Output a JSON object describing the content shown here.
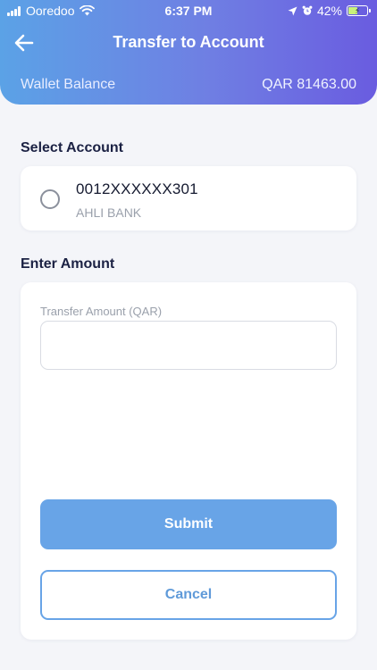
{
  "status_bar": {
    "carrier": "Ooredoo",
    "time": "6:37 PM",
    "battery": "42%"
  },
  "header": {
    "title": "Transfer to Account",
    "wallet_label": "Wallet Balance",
    "wallet_value": "QAR 81463.00"
  },
  "select_account": {
    "title": "Select Account",
    "account": {
      "number": "0012XXXXXX301",
      "bank": "AHLI BANK",
      "selected": false
    }
  },
  "amount": {
    "title": "Enter Amount",
    "field_label": "Transfer Amount (QAR)",
    "value": "",
    "submit_label": "Submit",
    "cancel_label": "Cancel"
  },
  "colors": {
    "header_gradient": [
      "#5ba2e6",
      "#6a5ce0"
    ],
    "primary": "#68a4e7",
    "background": "#f4f5f9"
  }
}
